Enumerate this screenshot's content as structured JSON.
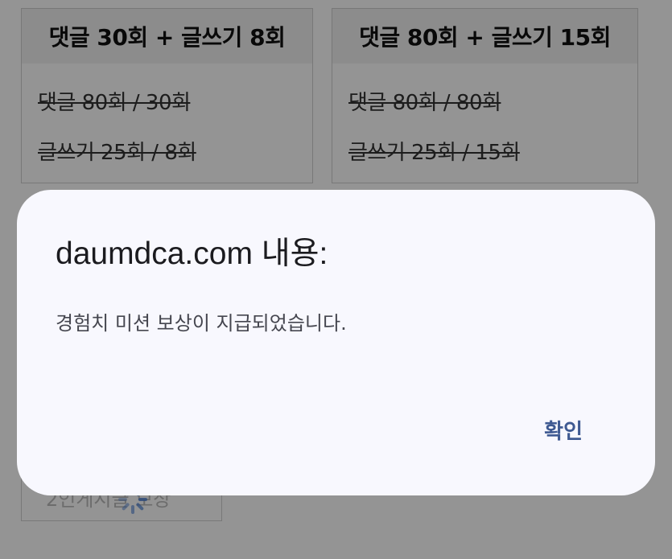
{
  "background": {
    "cards": [
      {
        "header": "댓글 30회 + 글쓰기 8회",
        "line1": "댓글 80회 / 30회",
        "line2": "글쓰기 25회 / 8회"
      },
      {
        "header": "댓글 80회 + 글쓰기 15회",
        "line1": "댓글 80회 / 80회",
        "line2": "글쓰기 25회 / 15회"
      }
    ],
    "bottom_label": "2인게시글 보상"
  },
  "dialog": {
    "title": "daumdca.com 내용:",
    "message": "경험치 미션 보상이 지급되었습니다.",
    "confirm_label": "확인"
  },
  "colors": {
    "dialog_bg": "#f8f8fe",
    "confirm_text": "#3f5a92",
    "overlay": "rgba(0,0,0,0.42)"
  },
  "icons": {
    "loading": "loading-spinner-icon"
  }
}
